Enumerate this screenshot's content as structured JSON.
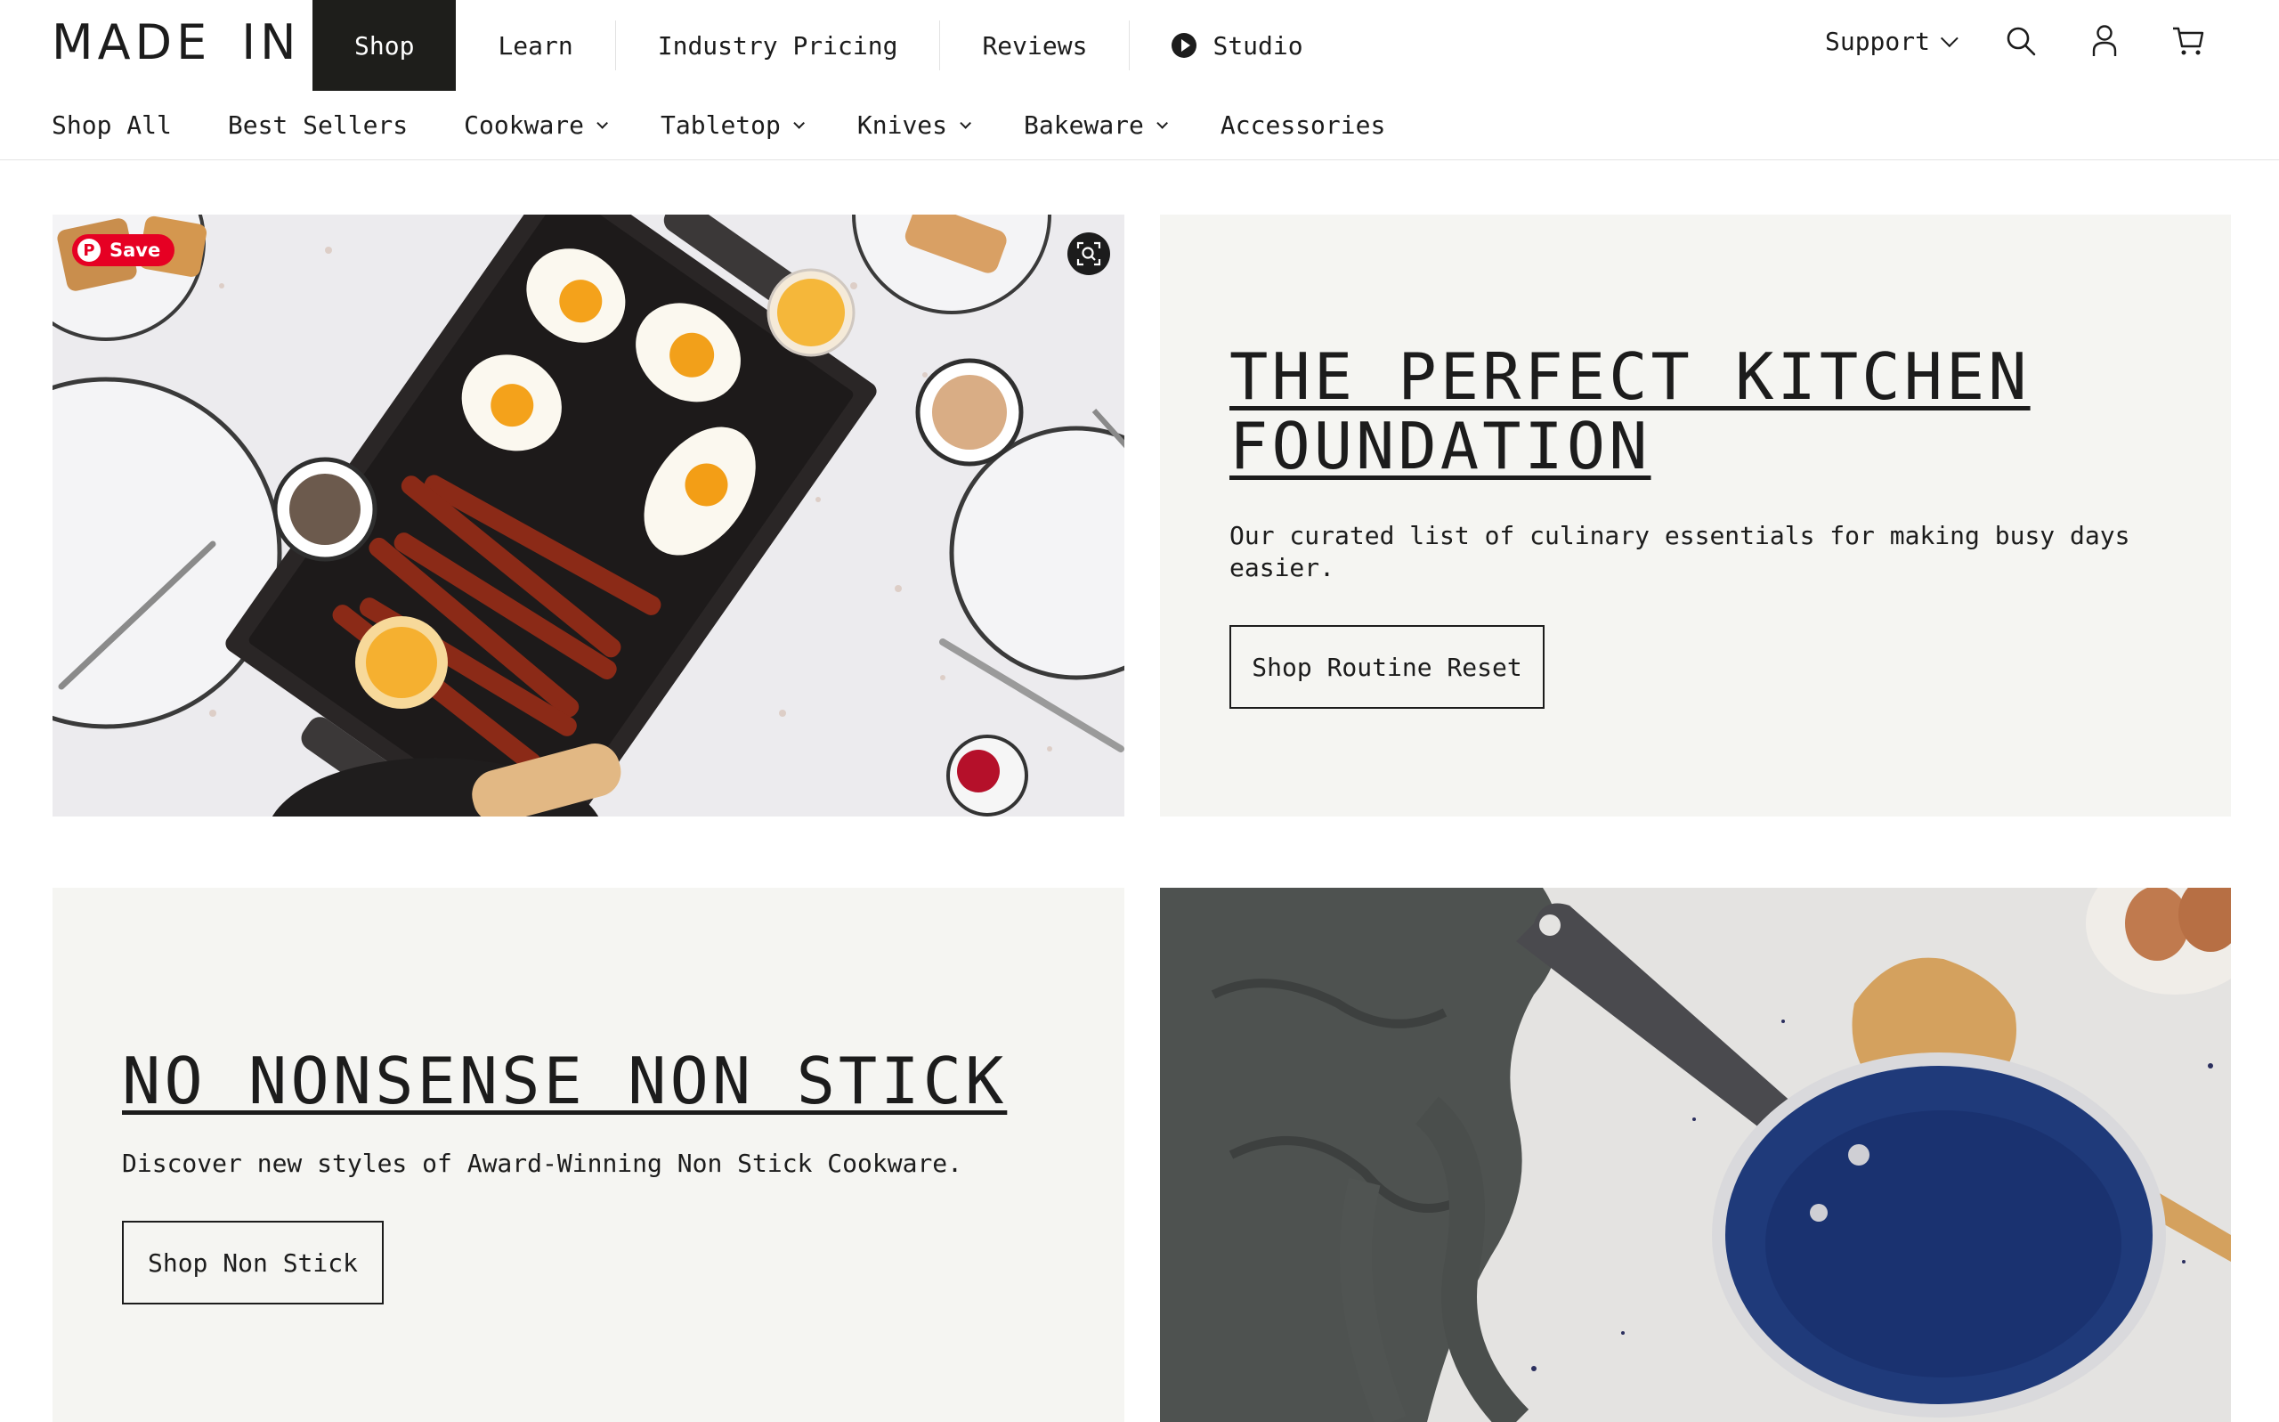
{
  "brand": {
    "logo_left": "MADE",
    "logo_right": "IN"
  },
  "main_nav": {
    "shop": "Shop",
    "learn": "Learn",
    "industry_pricing": "Industry Pricing",
    "reviews": "Reviews",
    "studio": "Studio"
  },
  "right_nav": {
    "support": "Support",
    "icons": [
      "search-icon",
      "account-icon",
      "cart-icon"
    ]
  },
  "sub_nav": {
    "shop_all": "Shop All",
    "best_sellers": "Best Sellers",
    "cookware": "Cookware",
    "tabletop": "Tabletop",
    "knives": "Knives",
    "bakeware": "Bakeware",
    "accessories": "Accessories"
  },
  "pinterest": {
    "save_label": "Save"
  },
  "card1": {
    "title": "THE PERFECT KITCHEN FOUNDATION",
    "description": "Our curated list of culinary essentials for making busy days easier.",
    "button": "Shop Routine Reset"
  },
  "card2": {
    "title": "NO NONSENSE NON STICK",
    "description": "Discover new styles of Award-Winning Non Stick Cookware.",
    "button": "Shop Non Stick"
  },
  "colors": {
    "active_nav_bg": "#1e1e1b",
    "card_bg": "#f5f5f2",
    "pinterest_red": "#e60023",
    "pan_blue": "#1f3a7a"
  }
}
